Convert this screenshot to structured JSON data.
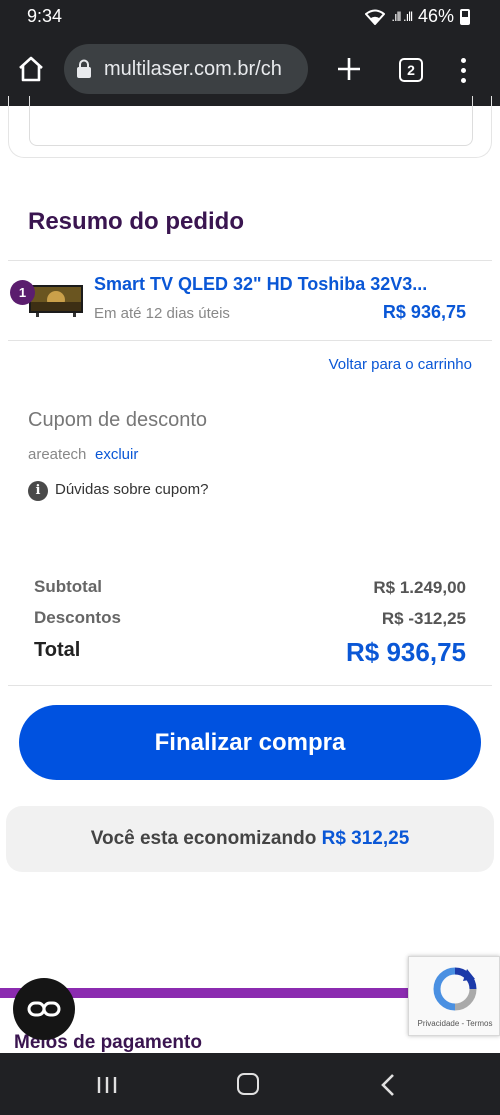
{
  "status_bar": {
    "time": "9:34",
    "battery": "46%",
    "signal": ".ıll .ıll"
  },
  "browser": {
    "url": "multilaser.com.br/ch",
    "tab_count": "2"
  },
  "summary": {
    "title": "Resumo do pedido"
  },
  "product": {
    "quantity": "1",
    "name": "Smart TV QLED 32\" HD Toshiba 32V3...",
    "shipping": "Em até 12 dias úteis",
    "price": "R$ 936,75"
  },
  "back_to_cart": "Voltar para o carrinho",
  "coupon": {
    "label": "Cupom de desconto",
    "code": "areatech",
    "remove": "excluir",
    "help": "Dúvidas sobre cupom?"
  },
  "totals": {
    "subtotal_label": "Subtotal",
    "subtotal_value": "R$ 1.249,00",
    "discount_label": "Descontos",
    "discount_value": "R$ -312,25",
    "total_label": "Total",
    "total_value": "R$ 936,75"
  },
  "checkout_button": "Finalizar compra",
  "savings": {
    "text": "Você esta economizando",
    "amount": "R$ 312,25"
  },
  "payment": {
    "title": "Meios de pagamento"
  },
  "recaptcha": {
    "links": "Privacidade - Termos"
  },
  "colors": {
    "brand_purple": "#3a1550",
    "accent_blue": "#0a57d6",
    "button_blue": "#0052e0",
    "bar_purple": "#8b2bb0"
  }
}
